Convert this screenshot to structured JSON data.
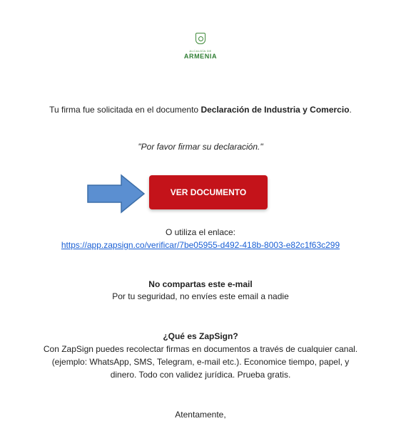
{
  "logo": {
    "small": "ALCALDÍA DE",
    "big": "ARMENIA"
  },
  "intro": {
    "prefix": "Tu firma fue solicitada en el documento ",
    "doc_name": "Declaración de Industria y Comercio",
    "suffix": "."
  },
  "message": "\"Por favor firmar su declaración.\"",
  "button_label": "VER DOCUMENTO",
  "link_intro": "O utiliza el enlace:",
  "link_url": "https://app.zapsign.co/verificar/7be05955-d492-418b-8003-e82c1f63c299",
  "warning": {
    "title": "No compartas este e-mail",
    "body": "Por tu seguridad, no envíes este email a nadie"
  },
  "about": {
    "title": "¿Qué es ZapSign?",
    "lines": [
      "Con ZapSign puedes recolectar firmas en documentos a través de cualquier canal.",
      "(ejemplo: WhatsApp, SMS, Telegram, e-mail etc.). Economice tiempo, papel, y",
      "dinero. Todo con validez jurídica. Prueba gratis."
    ]
  },
  "closing": "Atentamente,",
  "colors": {
    "button": "#c4131a",
    "arrow": "#5b8fd1",
    "link": "#1a5fd4",
    "logo": "#2e7d32"
  }
}
